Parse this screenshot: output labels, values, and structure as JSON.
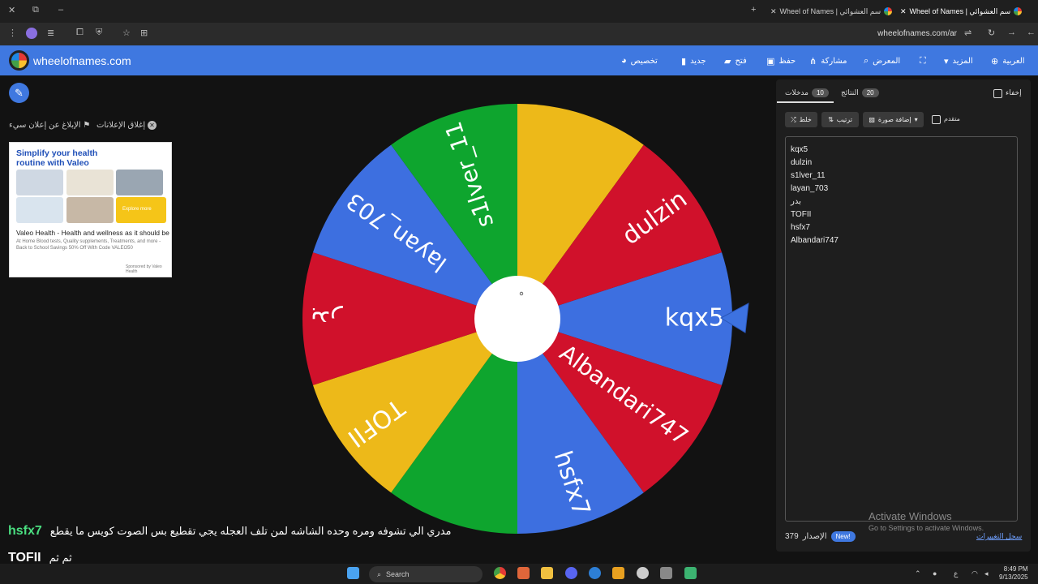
{
  "browser": {
    "tabs": [
      {
        "title": "Wheel of Names | سم العشوائي"
      },
      {
        "title": "Wheel of Names | سم العشوائي"
      }
    ],
    "new_tab": "+",
    "url": "wheelofnames.com/ar"
  },
  "app": {
    "brand": "wheelofnames.com",
    "menu": {
      "customize": "تخصيص",
      "new": "جديد",
      "open": "فتح",
      "save": "حفظ",
      "share": "مشاركة",
      "gallery": "المعرض",
      "more": "المزيد",
      "language": "العربية"
    }
  },
  "left": {
    "report_ad": "الإبلاغ عن إعلان سيء",
    "close_ads": "إغلاق الإعلانات",
    "ad": {
      "title": "Simplify your health routine with Valeo",
      "heading": "Valeo Health - Health and wellness as it should be",
      "body": "At Home Blood tests, Quality supplements, Treatments, and more - Back to School Savings 50% Off With Code VALEO50",
      "sponsored": "Sponsored by Valeo Health",
      "cta": "Explore more"
    }
  },
  "wheel": {
    "segments": [
      {
        "label": "kqx5",
        "color": "#3d6fe0"
      },
      {
        "label": "Albandari747",
        "color": "#d0112b"
      },
      {
        "label": "hsfx7",
        "color": "#3d6fe0"
      },
      {
        "label": "",
        "color": "#0ea52e"
      },
      {
        "label": "TOFII",
        "color": "#edb919"
      },
      {
        "label": "بدر",
        "color": "#d0112b"
      },
      {
        "label": "layan_703",
        "color": "#3d6fe0"
      },
      {
        "label": "s1lver_11",
        "color": "#0ea52e"
      },
      {
        "label": "",
        "color": "#edb919"
      },
      {
        "label": "dulzin",
        "color": "#d0112b"
      }
    ]
  },
  "panel": {
    "hide_label": "إخفاء",
    "results_label": "النتائج",
    "results_count": "20",
    "entries_label": "مدخلات",
    "entries_count": "10",
    "shuffle": "خلط",
    "sort": "ترتيب",
    "add_image": "إضافة صورة",
    "advanced": "متقدم",
    "entries": [
      "kqx5",
      "dulzin",
      "s1lver_11",
      "layan_703",
      "بدر",
      "TOFII",
      "hsfx7",
      "Albandari747"
    ],
    "version_label": "الإصدار",
    "version": "379",
    "new_badge": "New!",
    "changelog": "سجل التغييرات"
  },
  "windows": {
    "activate_title": "Activate Windows",
    "activate_sub": "Go to Settings to activate Windows."
  },
  "captions": {
    "line1": "مدري الي تشوفه ومره وحده الشاشه لمن تلف العجله يجي تقطيع بس الصوت كويس ما يقطع",
    "line1_name": "hsfx7",
    "line2": "ثم ثم",
    "line2_name": "TOFII"
  },
  "taskbar": {
    "search": "Search",
    "time": "8:49 PM",
    "date": "9/13/2025"
  }
}
